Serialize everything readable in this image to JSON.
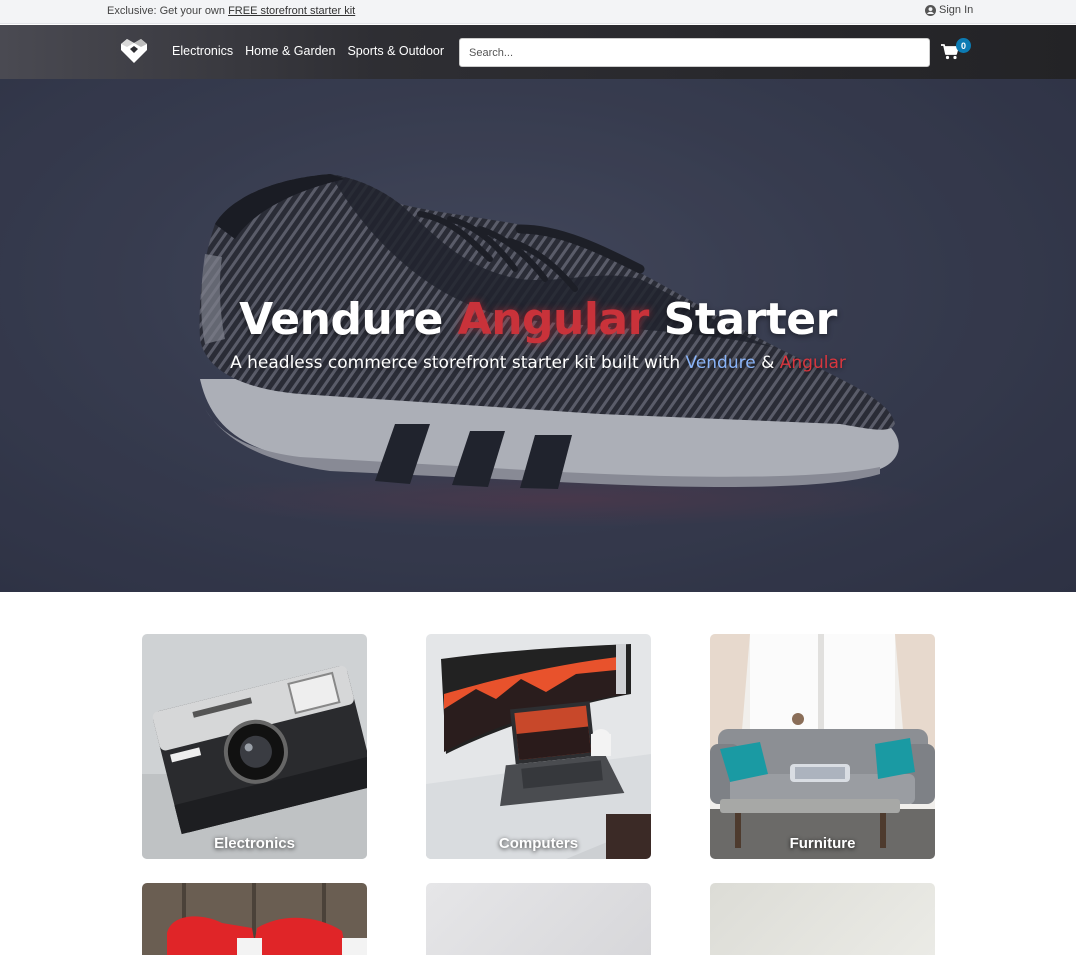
{
  "topbar": {
    "promo_text": "Exclusive: Get your own ",
    "promo_link": "FREE storefront starter kit",
    "signin_label": "Sign In"
  },
  "header": {
    "nav": [
      "Electronics",
      "Home & Garden",
      "Sports & Outdoor"
    ],
    "search_placeholder": "Search...",
    "cart_count": "0"
  },
  "hero": {
    "title_part1": "Vendure ",
    "title_part2": "Angular",
    "title_part3": " Starter",
    "subtitle_part1": "A headless commerce storefront starter kit built with ",
    "subtitle_vendure": "Vendure",
    "subtitle_amp": " & ",
    "subtitle_angular": "Angular"
  },
  "categories": [
    {
      "label": "Electronics"
    },
    {
      "label": "Computers"
    },
    {
      "label": "Furniture"
    }
  ],
  "colors": {
    "accent_red": "#c9323a",
    "accent_blue": "#8ab4f8",
    "badge": "#0c7bb3"
  }
}
